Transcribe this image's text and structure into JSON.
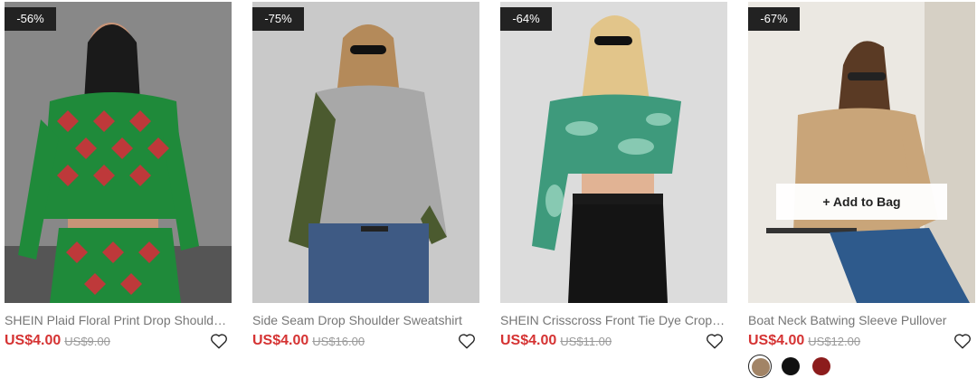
{
  "products": [
    {
      "discount": "-56%",
      "title": "SHEIN Plaid Floral Print Drop Shoulde…",
      "price": "US$4.00",
      "original_price": "US$9.00",
      "colors": {
        "bg": "#8a8a8a",
        "garment": "#1f8a3a",
        "accent": "#d0313a"
      }
    },
    {
      "discount": "-75%",
      "title": "Side Seam Drop Shoulder Sweatshirt",
      "price": "US$4.00",
      "original_price": "US$16.00",
      "colors": {
        "bg": "#c7c7c7",
        "garment": "#a9a9a9",
        "accent": "#4a5a2e"
      }
    },
    {
      "discount": "-64%",
      "title": "SHEIN Crisscross Front Tie Dye Crop …",
      "price": "US$4.00",
      "original_price": "US$11.00",
      "colors": {
        "bg": "#dcdcdc",
        "garment": "#3e9a7c",
        "accent": "#161616"
      }
    },
    {
      "discount": "-67%",
      "title": "Boat Neck Batwing Sleeve Pullover",
      "price": "US$4.00",
      "original_price": "US$12.00",
      "add_to_bag": "+ Add to Bag",
      "colors": {
        "bg": "#e9e6e0",
        "garment": "#c9a579",
        "accent": "#2e5a8c"
      },
      "swatches": [
        "#a28466",
        "#111111",
        "#8c1c1c"
      ]
    }
  ]
}
